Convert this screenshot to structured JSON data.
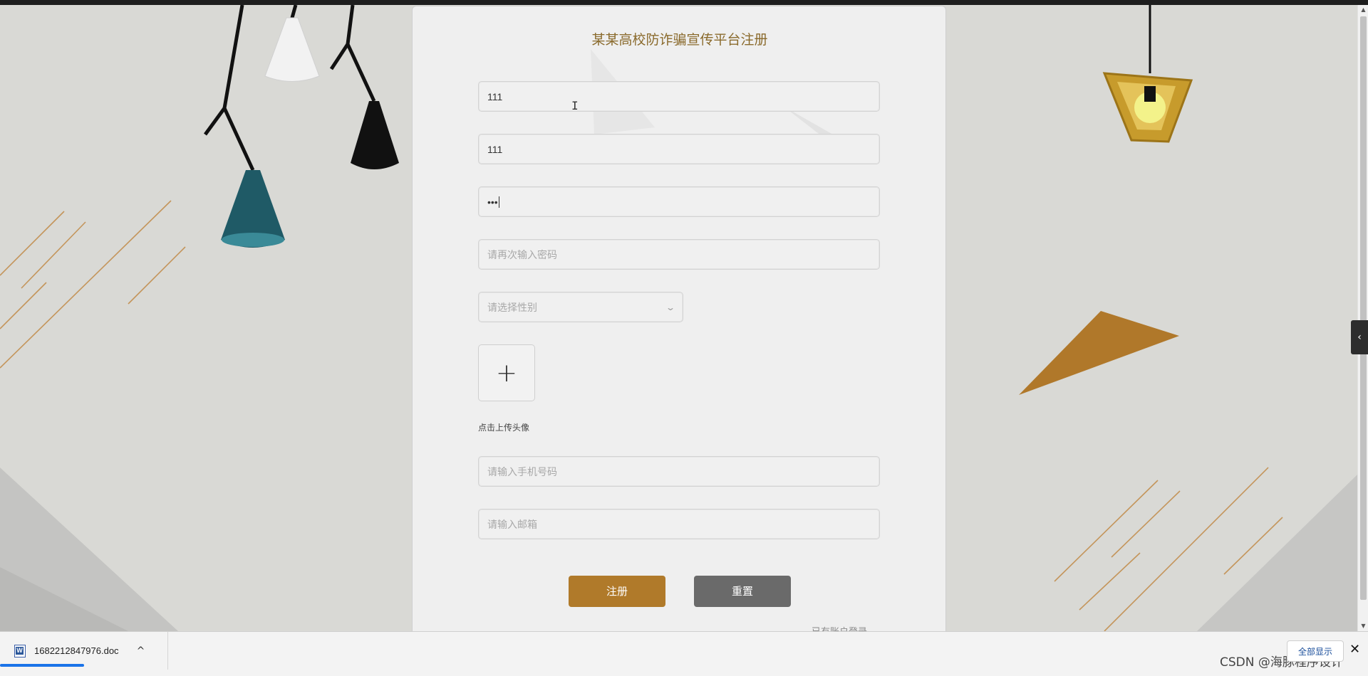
{
  "form": {
    "title": "某某高校防诈骗宣传平台注册",
    "fields": [
      {
        "value": "111",
        "placeholder": ""
      },
      {
        "value": "111",
        "placeholder": ""
      },
      {
        "value": "•••",
        "placeholder": ""
      },
      {
        "value": "",
        "placeholder": "请再次输入密码"
      },
      {
        "value": "",
        "placeholder": "请选择性别"
      },
      {
        "value": "",
        "placeholder": "请输入手机号码"
      },
      {
        "value": "",
        "placeholder": "请输入邮箱"
      }
    ],
    "upload_label": "点击上传头像",
    "register_label": "注册",
    "reset_label": "重置",
    "login_link": "已有账户登录"
  },
  "download_bar": {
    "file_name": "1682212847976.doc",
    "show_all_label": "全部显示",
    "close_label": "✕",
    "chevron": "^",
    "progress": 0.5
  },
  "watermark": "CSDN @海豚程序设计",
  "colors": {
    "accent": "#b07a2a",
    "reset_button": "#6a6a6a",
    "title": "#8a6a2c"
  }
}
